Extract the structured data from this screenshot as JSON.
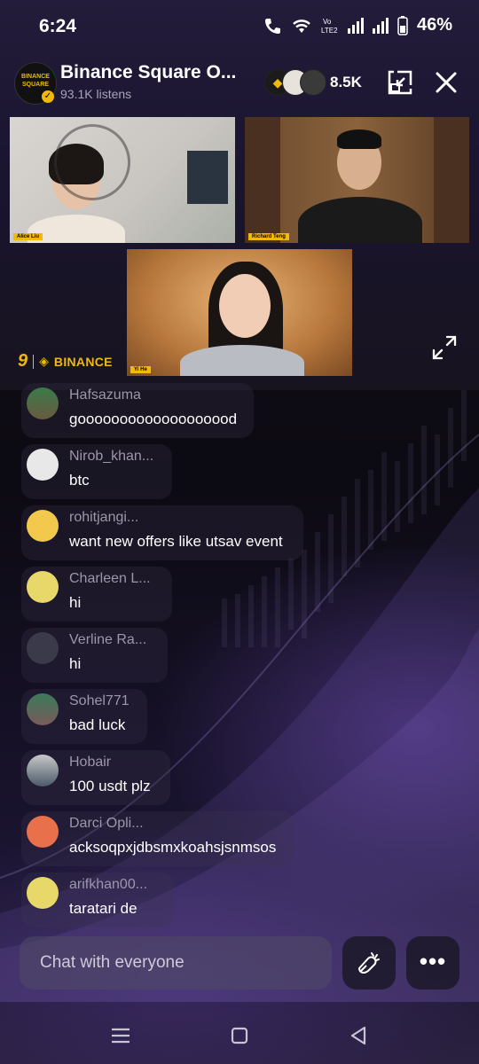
{
  "status_bar": {
    "time": "6:24",
    "battery": "46%"
  },
  "header": {
    "title": "Binance Square O...",
    "listens": "93.1K listens",
    "listener_count": "8.5K",
    "logo_top": "BINANCE",
    "logo_bottom": "SQUARE"
  },
  "video": {
    "speakers": [
      {
        "name": "Alice Liu"
      },
      {
        "name": "Richard Teng"
      },
      {
        "name": "Yi He"
      }
    ],
    "brand_logo": "9",
    "brand_name": "BINANCE"
  },
  "chat": {
    "messages": [
      {
        "user": "Hafsazuma",
        "text": "gooooooooooooooooood"
      },
      {
        "user": "Nirob_khan...",
        "text": "btc"
      },
      {
        "user": "rohitjangi...",
        "text": "want new offers like utsav event"
      },
      {
        "user": "Charleen L...",
        "text": "hi"
      },
      {
        "user": "Verline Ra...",
        "text": "hi"
      },
      {
        "user": "Sohel771",
        "text": "bad luck"
      },
      {
        "user": "Hobair",
        "text": "100 usdt plz"
      },
      {
        "user": "Darci Opli...",
        "text": "acksoqpxjdbsmxkoahsjsnmsos"
      },
      {
        "user": "arifkhan00...",
        "text": "taratari de"
      }
    ]
  },
  "bottom_bar": {
    "chat_placeholder": "Chat with everyone",
    "more_label": "•••"
  },
  "colors": {
    "accent": "#f0b90b",
    "background": "#141018"
  }
}
